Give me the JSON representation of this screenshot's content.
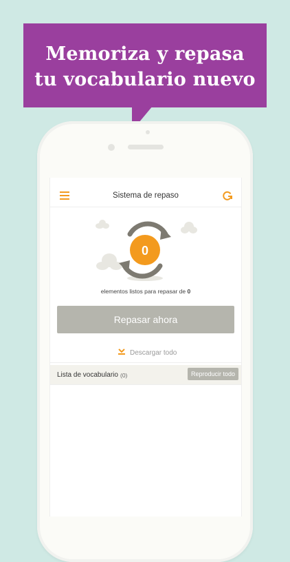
{
  "banner": {
    "line1": "Memoriza y repasa",
    "line2": "tu vocabulario nuevo"
  },
  "appbar": {
    "title": "Sistema de repaso",
    "menu_icon": "menu-icon",
    "refresh_icon": "refresh-icon"
  },
  "review": {
    "count_value": "0",
    "count_label": "elementos listos para repasar de",
    "count_total": "0",
    "button_label": "Repasar ahora"
  },
  "download": {
    "label": "Descargar todo",
    "icon": "download-icon"
  },
  "vocab": {
    "title": "Lista de vocabulario",
    "count": "(0)",
    "play_all_label": "Reproducir todo"
  },
  "colors": {
    "accent": "#f39a1e",
    "banner": "#9a3f9e",
    "background": "#cfe9e4",
    "button": "#b5b5ad"
  }
}
